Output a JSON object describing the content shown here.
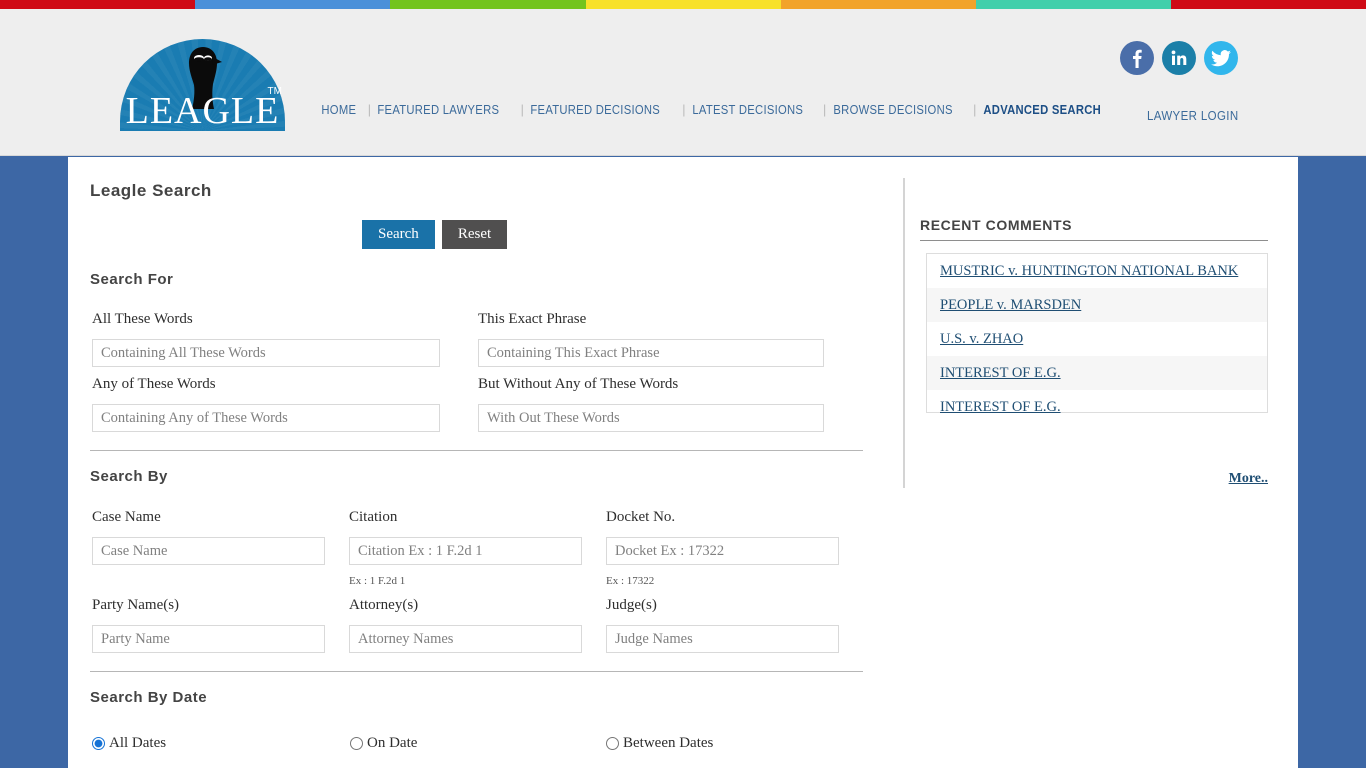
{
  "topbar": {
    "segments": [
      "#cf0a16",
      "#4a90d9",
      "#73c41d",
      "#f7e12a",
      "#f2a32a",
      "#42cfab",
      "#cf0a16"
    ]
  },
  "header": {
    "logo": {
      "text": "LEAGLE",
      "trademark": "TM",
      "dome_color": "#1a7cb2",
      "bird_icon": "eagle-icon"
    },
    "nav": [
      {
        "label": "HOME",
        "active": false
      },
      {
        "label": "FEATURED LAWYERS",
        "active": false
      },
      {
        "label": "FEATURED DECISIONS",
        "active": false
      },
      {
        "label": "LATEST DECISIONS",
        "active": false
      },
      {
        "label": "BROWSE DECISIONS",
        "active": false
      },
      {
        "label": "ADVANCED SEARCH",
        "active": true
      }
    ],
    "social": [
      {
        "name": "facebook-icon",
        "glyph": "f",
        "color": "#4a6ea9"
      },
      {
        "name": "linkedin-icon",
        "glyph": "in",
        "color": "#1b7fa8"
      },
      {
        "name": "twitter-icon",
        "glyph": "t",
        "color": "#31b6ec"
      }
    ],
    "lawyer_login": "LAWYER LOGIN"
  },
  "main": {
    "page_title": "Leagle  Search",
    "buttons": {
      "search": "Search",
      "reset": "Reset"
    },
    "search_for": {
      "heading": "Search  For",
      "fields": [
        {
          "label": "All These Words",
          "placeholder": "Containing All These Words",
          "value": ""
        },
        {
          "label": "This Exact Phrase",
          "placeholder": "Containing This Exact Phrase",
          "value": ""
        },
        {
          "label": "Any of These Words",
          "placeholder": "Containing Any of These Words",
          "value": ""
        },
        {
          "label": "But Without Any of These Words",
          "placeholder": "With Out These Words",
          "value": ""
        }
      ]
    },
    "search_by": {
      "heading": "Search  By",
      "fields": [
        {
          "label": "Case Name",
          "placeholder": "Case Name",
          "value": "",
          "hint": ""
        },
        {
          "label": "Citation",
          "placeholder": "Citation Ex : 1 F.2d 1",
          "value": "",
          "hint": "Ex : 1 F.2d 1"
        },
        {
          "label": "Docket No.",
          "placeholder": "Docket Ex : 17322",
          "value": "",
          "hint": "Ex : 17322"
        },
        {
          "label": "Party Name(s)",
          "placeholder": "Party Name",
          "value": "",
          "hint": ""
        },
        {
          "label": "Attorney(s)",
          "placeholder": "Attorney Names",
          "value": "",
          "hint": ""
        },
        {
          "label": "Judge(s)",
          "placeholder": "Judge Names",
          "value": "",
          "hint": ""
        }
      ]
    },
    "search_by_date": {
      "heading": "Search  By  Date",
      "options": [
        {
          "label": "All Dates",
          "selected": true
        },
        {
          "label": "On Date",
          "selected": false
        },
        {
          "label": "Between Dates",
          "selected": false
        }
      ]
    }
  },
  "sidebar": {
    "title": "RECENT  COMMENTS",
    "items": [
      {
        "label": "MUSTRIC v. HUNTINGTON NATIONAL BANK"
      },
      {
        "label": "PEOPLE v. MARSDEN"
      },
      {
        "label": "U.S. v. ZHAO"
      },
      {
        "label": "INTEREST OF E.G."
      },
      {
        "label": "INTEREST OF E.G."
      }
    ],
    "more": "More.."
  },
  "colors": {
    "page_background": "#3d67a5",
    "header_background": "#eeeeee",
    "accent_blue": "#1a72a8",
    "link_blue": "#1f4e73",
    "reset_gray": "#504f4f"
  }
}
